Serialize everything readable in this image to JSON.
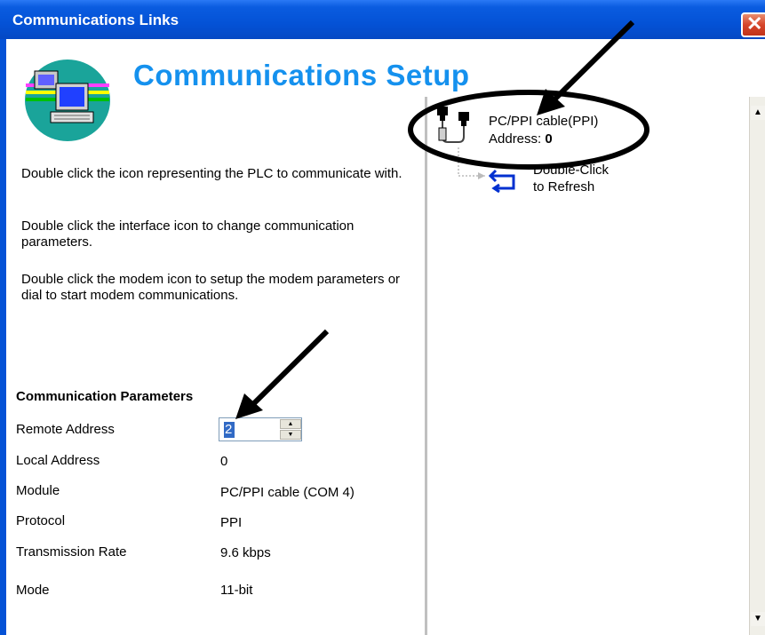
{
  "window": {
    "title": "Communications Links",
    "close_glyph": "✕"
  },
  "header": {
    "title": "Communications Setup"
  },
  "instructions": [
    "Double click the icon representing the PLC to communicate with.",
    "Double click the interface icon to change communication parameters.",
    "Double click the modem icon to setup the modem parameters or dial to start modem communications."
  ],
  "params": {
    "heading": "Communication Parameters",
    "remote_address_label": "Remote Address",
    "remote_address_value": "2",
    "local_address_label": "Local Address",
    "local_address_value": "0",
    "module_label": "Module",
    "module_value": "PC/PPI cable (COM 4)",
    "protocol_label": "Protocol",
    "protocol_value": "PPI",
    "rate_label": "Transmission Rate",
    "rate_value": "9.6 kbps",
    "mode_label": "Mode",
    "mode_value": "11-bit"
  },
  "tree": {
    "cable_name": "PC/PPI cable(PPI)",
    "address_label": "Address:",
    "address_value": "0",
    "refresh_line1": "Double-Click",
    "refresh_line2": "to Refresh"
  },
  "colors": {
    "titlebar": "#0452d6",
    "header_title": "#1591ee",
    "annotation": "#000000"
  },
  "icons": [
    "communications-setup-logo-icon",
    "pc-ppi-cable-icon",
    "refresh-icon",
    "close-icon",
    "spin-up-icon",
    "spin-down-icon"
  ]
}
